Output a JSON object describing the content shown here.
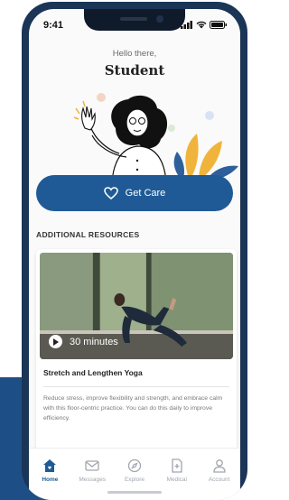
{
  "status_bar": {
    "time": "9:41"
  },
  "header": {
    "greeting": "Hello there,",
    "name": "Student"
  },
  "cta": {
    "label": "Get Care",
    "icon": "heart-icon"
  },
  "resources": {
    "section_title": "ADDITIONAL RESOURCES",
    "card": {
      "duration": "30 minutes",
      "title": "Stretch and Lengthen Yoga",
      "description": "Reduce stress, improve flexibility and strength, and embrace calm with this floor-centric practice. You can do this daily to improve efficiency."
    }
  },
  "tabs": [
    {
      "label": "Home",
      "icon": "home-icon",
      "active": true
    },
    {
      "label": "Messages",
      "icon": "mail-icon",
      "active": false
    },
    {
      "label": "Explore",
      "icon": "compass-icon",
      "active": false
    },
    {
      "label": "Medical",
      "icon": "medical-file-icon",
      "active": false
    },
    {
      "label": "Account",
      "icon": "user-icon",
      "active": false
    }
  ],
  "colors": {
    "primary": "#1f5a96",
    "phone_frame": "#1b3557",
    "background_block": "#1d4f86"
  }
}
